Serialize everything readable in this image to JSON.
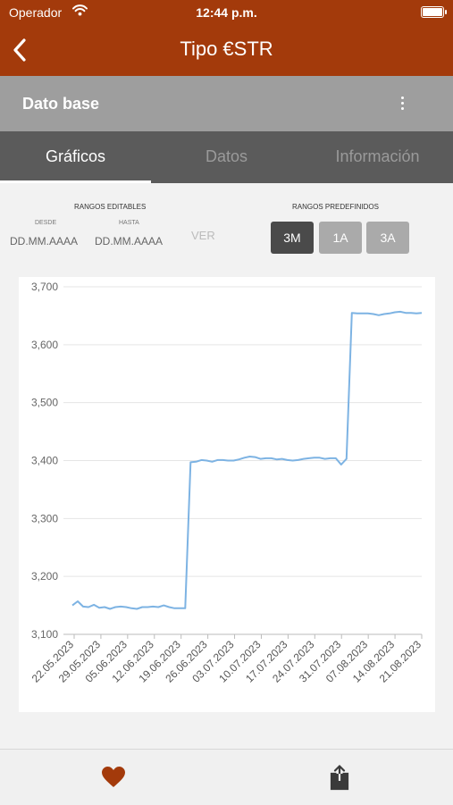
{
  "status": {
    "carrier": "Operador",
    "time": "12:44 p.m."
  },
  "nav": {
    "title": "Tipo €STR"
  },
  "subheader": {
    "title": "Dato base"
  },
  "tabs": [
    {
      "label": "Gráficos",
      "active": true
    },
    {
      "label": "Datos",
      "active": false
    },
    {
      "label": "Información",
      "active": false
    }
  ],
  "ranges": {
    "editable_title": "RANGOS EDITABLES",
    "from_label": "DESDE",
    "to_label": "HASTA",
    "from_value": "DD.MM.AAAA",
    "to_value": "DD.MM.AAAA",
    "view_label": "VER",
    "predefined_title": "RANGOS PREDEFINIDOS",
    "buttons": [
      {
        "label": "3M",
        "active": true
      },
      {
        "label": "1A",
        "active": false
      },
      {
        "label": "3A",
        "active": false
      }
    ]
  },
  "colors": {
    "brand": "#a33a0b",
    "series": "#7db3e3",
    "active_range": "#4a4a4a"
  },
  "icons": {
    "back": "chevron-left-icon",
    "more": "more-vertical-icon",
    "favorite": "heart-icon",
    "share": "share-icon"
  },
  "chart_data": {
    "type": "line",
    "ylim": [
      3.1,
      3.7
    ],
    "yticks": [
      "3,100",
      "3,200",
      "3,300",
      "3,400",
      "3,500",
      "3,600",
      "3,700"
    ],
    "xticks": [
      "22.05.2023",
      "29.05.2023",
      "05.06.2023",
      "12.06.2023",
      "19.06.2023",
      "26.06.2023",
      "03.07.2023",
      "10.07.2023",
      "17.07.2023",
      "24.07.2023",
      "31.07.2023",
      "07.08.2023",
      "14.08.2023",
      "21.08.2023"
    ],
    "grid": true,
    "series": [
      {
        "values": [
          3.15,
          3.157,
          3.148,
          3.147,
          3.151,
          3.146,
          3.147,
          3.144,
          3.147,
          3.148,
          3.147,
          3.145,
          3.144,
          3.147,
          3.147,
          3.148,
          3.147,
          3.15,
          3.147,
          3.145,
          3.145,
          3.145,
          3.397,
          3.398,
          3.401,
          3.4,
          3.398,
          3.401,
          3.401,
          3.4,
          3.4,
          3.402,
          3.405,
          3.407,
          3.406,
          3.403,
          3.404,
          3.404,
          3.402,
          3.403,
          3.401,
          3.4,
          3.401,
          3.403,
          3.404,
          3.405,
          3.405,
          3.403,
          3.404,
          3.404,
          3.393,
          3.403,
          3.655,
          3.654,
          3.654,
          3.654,
          3.653,
          3.651,
          3.653,
          3.654,
          3.656,
          3.657,
          3.655,
          3.655,
          3.654,
          3.655
        ]
      }
    ]
  }
}
